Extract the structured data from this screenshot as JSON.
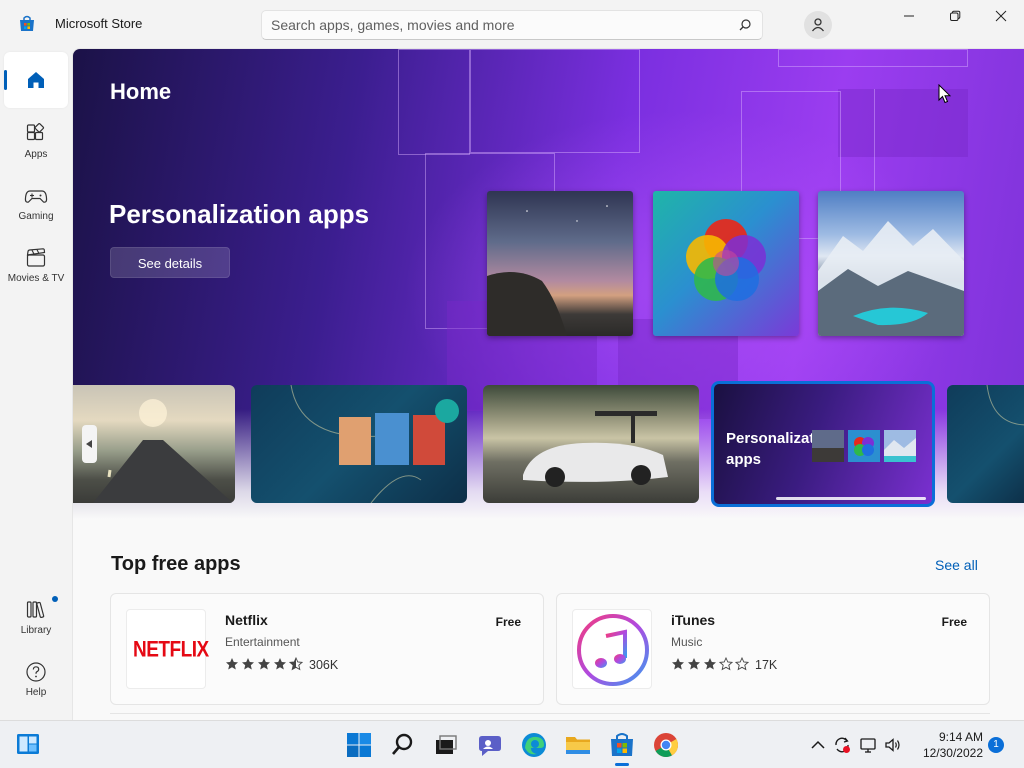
{
  "window": {
    "title": "Microsoft Store",
    "search_placeholder": "Search apps, games, movies and more"
  },
  "sidebar": {
    "items": [
      {
        "label": "Home",
        "icon": "home-icon",
        "active": true
      },
      {
        "label": "Apps",
        "icon": "apps-icon"
      },
      {
        "label": "Gaming",
        "icon": "gamepad-icon"
      },
      {
        "label": "Movies & TV",
        "icon": "clapperboard-icon"
      }
    ],
    "bottom_items": [
      {
        "label": "Library",
        "icon": "library-icon",
        "has_update": true
      },
      {
        "label": "Help",
        "icon": "help-icon"
      }
    ]
  },
  "hero": {
    "page_title": "Home",
    "title": "Personalization apps",
    "button_label": "See details"
  },
  "carousel": {
    "active_card_title": "Personalization apps",
    "active_index": 3
  },
  "top_free": {
    "title": "Top free apps",
    "see_all": "See all",
    "apps": [
      {
        "name": "Netflix",
        "category": "Entertainment",
        "rating": 4.5,
        "rating_count": "306K",
        "price": "Free",
        "icon_text": "NETFLIX"
      },
      {
        "name": "iTunes",
        "category": "Music",
        "rating": 3,
        "rating_count": "17K",
        "price": "Free"
      }
    ]
  },
  "taskbar": {
    "time": "9:14 AM",
    "date": "12/30/2022",
    "notification_count": "1"
  },
  "colors": {
    "accent": "#005fb8",
    "netflix_red": "#e50914"
  }
}
